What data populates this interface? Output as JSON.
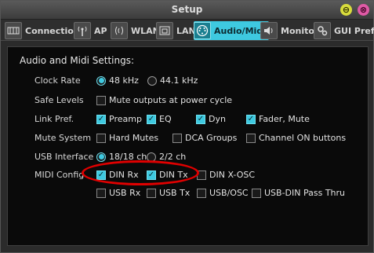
{
  "window": {
    "title": "Setup",
    "minimize_glyph": "⊖",
    "close_glyph": "⊗"
  },
  "tabs": [
    {
      "label": "Connection",
      "icon": "connection-icon",
      "active": false
    },
    {
      "label": "AP",
      "icon": "ap-antenna-icon",
      "active": false
    },
    {
      "label": "WLAN",
      "icon": "wlan-icon",
      "active": false
    },
    {
      "label": "LAN",
      "icon": "lan-icon",
      "active": false
    },
    {
      "label": "Audio/Midi",
      "icon": "midi-connector-icon",
      "active": true
    },
    {
      "label": "Monitor",
      "icon": "speaker-icon",
      "active": false
    },
    {
      "label": "GUI Prefs",
      "icon": "gears-icon",
      "active": false
    }
  ],
  "section": {
    "title": "Audio and Midi Settings:"
  },
  "rows": {
    "clock_rate": {
      "label": "Clock Rate",
      "opt1": "48 kHz",
      "opt2": "44.1 kHz",
      "selected": "48 kHz"
    },
    "safe_levels": {
      "label": "Safe Levels",
      "opt1": "Mute outputs at power cycle"
    },
    "link_pref": {
      "label": "Link Pref.",
      "opt1": "Preamp",
      "opt2": "EQ",
      "opt3": "Dyn",
      "opt4": "Fader, Mute"
    },
    "mute_system": {
      "label": "Mute System",
      "opt1": "Hard Mutes",
      "opt2": "DCA Groups",
      "opt3": "Channel ON buttons"
    },
    "usb_interface": {
      "label": "USB Interface",
      "opt1": "18/18 ch",
      "opt2": "2/2 ch",
      "selected": "18/18 ch"
    },
    "midi_config": {
      "label": "MIDI Config",
      "opt1": "DIN Rx",
      "opt2": "DIN Tx",
      "opt3": "DIN X-OSC"
    },
    "midi_config2": {
      "opt1": "USB Rx",
      "opt2": "USB Tx",
      "opt3": "USB/OSC",
      "opt4": "USB-DIN Pass Thru"
    }
  },
  "colors": {
    "accent": "#3ec9e0",
    "highlight": "#e00000"
  }
}
